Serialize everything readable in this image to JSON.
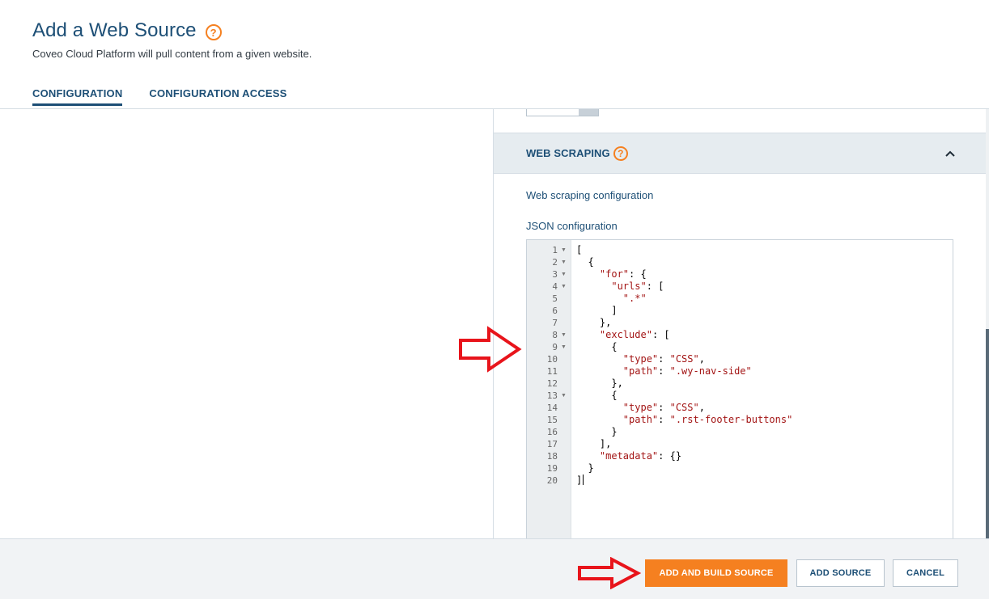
{
  "header": {
    "title": "Add a Web Source",
    "subtitle": "Coveo Cloud Platform will pull content from a given website.",
    "help_icon": "?",
    "tabs": [
      {
        "label": "CONFIGURATION",
        "active": true
      },
      {
        "label": "CONFIGURATION ACCESS",
        "active": false
      }
    ]
  },
  "section": {
    "title": "WEB SCRAPING",
    "help_icon": "?",
    "collapse_icon": "chevron-up-icon",
    "web_scraping_label": "Web scraping configuration",
    "json_label": "JSON configuration"
  },
  "editor": {
    "line_numbers": [
      "1",
      "2",
      "3",
      "4",
      "5",
      "6",
      "7",
      "8",
      "9",
      "10",
      "11",
      "12",
      "13",
      "14",
      "15",
      "16",
      "17",
      "18",
      "19",
      "20"
    ],
    "foldable_lines": [
      1,
      2,
      3,
      4,
      8,
      9,
      13
    ],
    "code_lines": [
      "[",
      "  {",
      "    \"for\": {",
      "      \"urls\": [",
      "        \".*\"",
      "      ]",
      "    },",
      "    \"exclude\": [",
      "      {",
      "        \"type\": \"CSS\",",
      "        \"path\": \".wy-nav-side\"",
      "      },",
      "      {",
      "        \"type\": \"CSS\",",
      "        \"path\": \".rst-footer-buttons\"",
      "      }",
      "    ],",
      "    \"metadata\": {}",
      "  }",
      "]"
    ]
  },
  "footer": {
    "primary_button": "ADD AND BUILD SOURCE",
    "add_button": "ADD SOURCE",
    "cancel_button": "CANCEL"
  },
  "colors": {
    "brand_blue": "#1d4f76",
    "accent_orange": "#f58020",
    "annotation_red": "#e8141b",
    "string_red": "#a31515"
  }
}
